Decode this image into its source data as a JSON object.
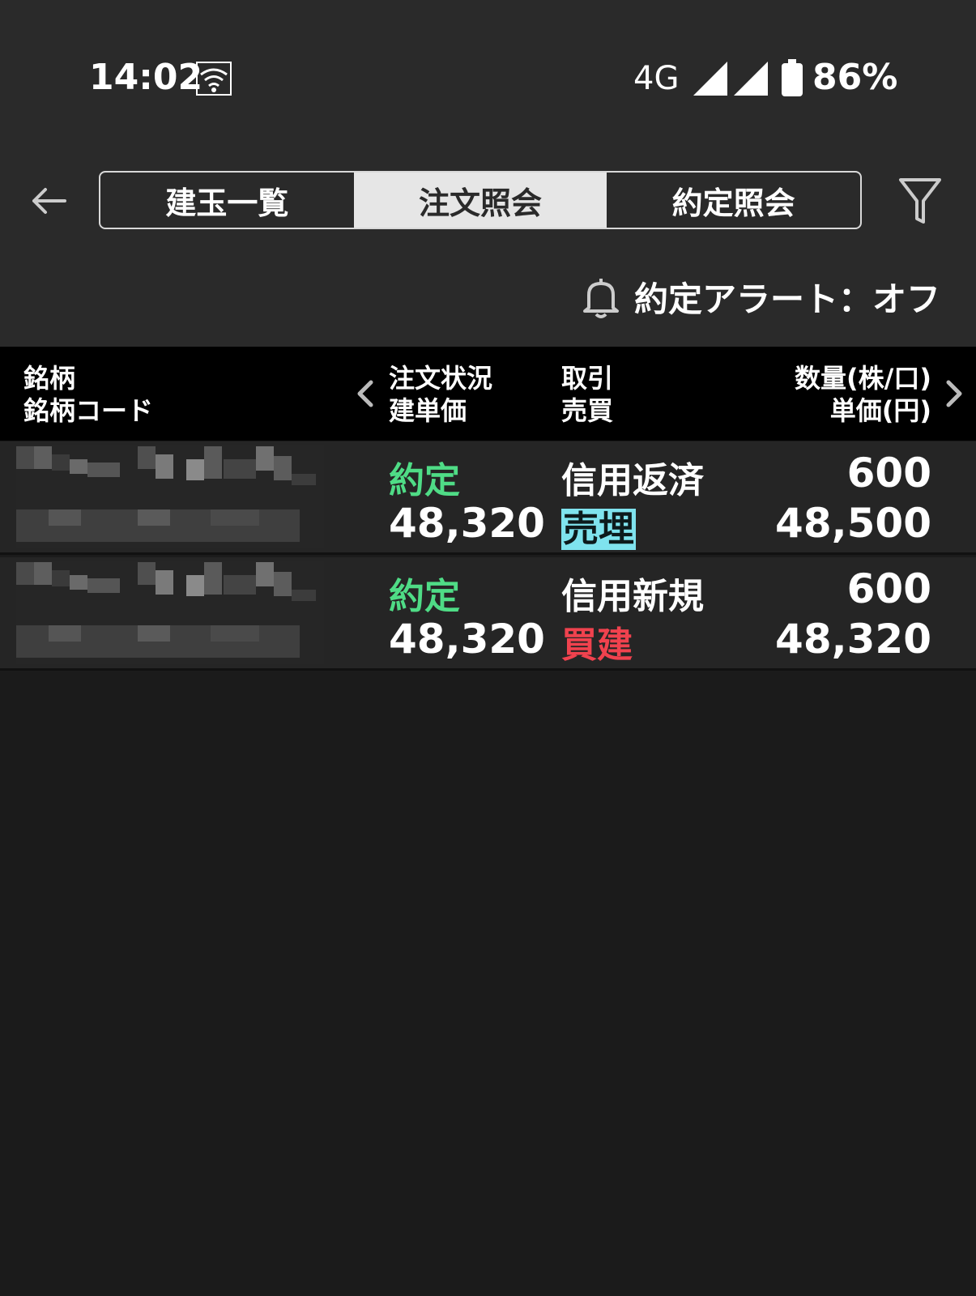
{
  "status_bar": {
    "time": "14:02",
    "network": "4G",
    "battery": "86%",
    "icons": [
      "wifi-icon",
      "signal-icon",
      "battery-icon"
    ]
  },
  "header": {
    "tabs": [
      {
        "label": "建玉一覧",
        "active": false
      },
      {
        "label": "注文照会",
        "active": true
      },
      {
        "label": "約定照会",
        "active": false
      }
    ],
    "icons": [
      "back-arrow-icon",
      "filter-icon"
    ]
  },
  "alert": {
    "label": "約定アラート：オフ",
    "icon": "bell-icon"
  },
  "table": {
    "headers": {
      "col1_line1": "銘柄",
      "col1_line2": "銘柄コード",
      "col2_line1": "注文状況",
      "col2_line2": "建単価",
      "col3_line1": "取引",
      "col3_line2": "売買",
      "col4_line1": "数量(株/口)",
      "col4_line2": "単価(円)"
    },
    "rows": [
      {
        "status": "約定",
        "build_price": "48,320",
        "trade_type": "信用返済",
        "side": "売埋",
        "quantity": "600",
        "unit_price": "48,500"
      },
      {
        "status": "約定",
        "build_price": "48,320",
        "trade_type": "信用新規",
        "side": "買建",
        "quantity": "600",
        "unit_price": "48,320"
      }
    ]
  },
  "colors": {
    "status_green": "#4fdc86",
    "sell_highlight": "#7fe3ee",
    "buy_red": "#f0424e",
    "background": "#1b1b1b",
    "header_bg": "#2a2a2a"
  }
}
